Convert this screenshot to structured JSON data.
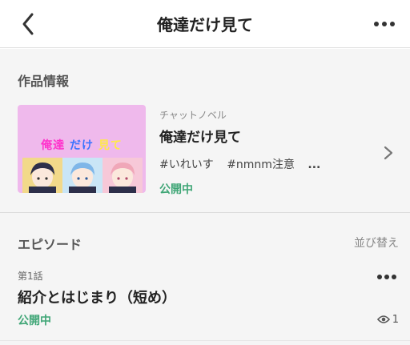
{
  "header": {
    "title": "俺達だけ見て",
    "back_icon": "chevron-left-icon",
    "more_icon": "more-horizontal-icon"
  },
  "work_info": {
    "heading": "作品情報",
    "thumbnail": {
      "title_part1": "俺達",
      "title_part2": "だけ",
      "title_part3": "見て",
      "colors": {
        "bg": "#efb9ec",
        "part1": "#ff33cc",
        "part2": "#3b74ff",
        "part3": "#ffe94a"
      }
    },
    "type": "チャットノベル",
    "title": "俺達だけ見て",
    "tags": [
      "#いれいす",
      "#nmnm注意"
    ],
    "tags_more": "...",
    "status": "公開中",
    "chevron_icon": "chevron-right-icon"
  },
  "episodes": {
    "heading": "エピソード",
    "sort_label": "並び替え",
    "items": [
      {
        "number": "第1話",
        "title": "紹介とはじまり（短め）",
        "status": "公開中",
        "views": "1",
        "views_icon": "eye-icon",
        "more_icon": "more-horizontal-icon"
      }
    ]
  },
  "colors": {
    "accent_green": "#3fa676",
    "section_bg": "#f5f5f5"
  }
}
